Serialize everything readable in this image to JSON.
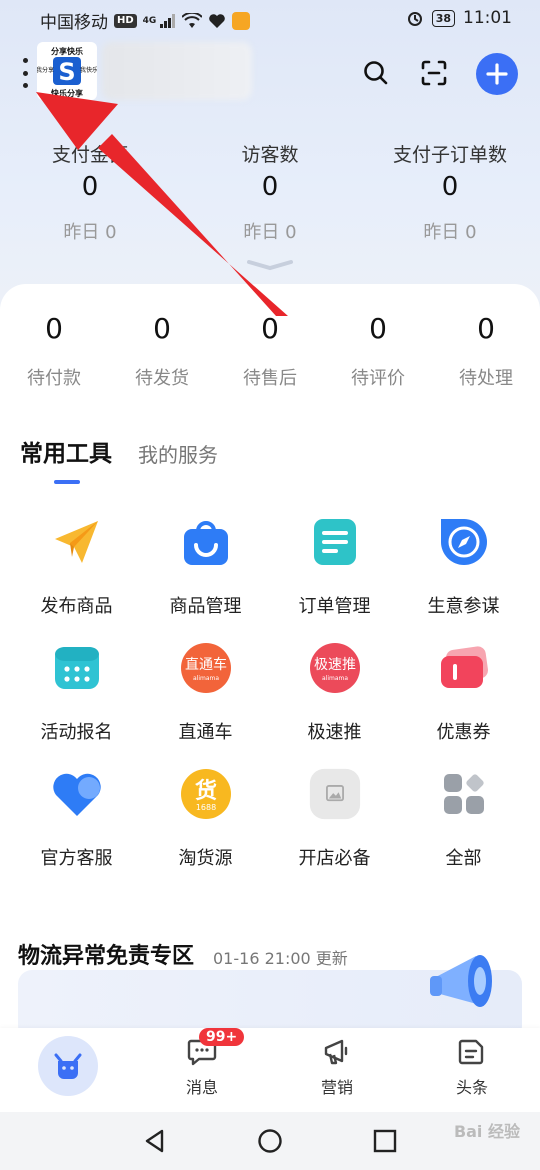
{
  "status_bar": {
    "carrier": "中国移动",
    "hd": "HD",
    "network": "4G",
    "battery": "38",
    "time": "11:01"
  },
  "header": {
    "logo_text_top": "分享快乐",
    "logo_text_bottom": "快乐分享",
    "logo_text_left": "我分享",
    "logo_text_right": "我快乐",
    "logo_letter": "S"
  },
  "stats": [
    {
      "label": "支付金额",
      "value": "0",
      "yesterday": "昨日 0"
    },
    {
      "label": "访客数",
      "value": "0",
      "yesterday": "昨日 0"
    },
    {
      "label": "支付子订单数",
      "value": "0",
      "yesterday": "昨日 0"
    }
  ],
  "orders": [
    {
      "value": "0",
      "label": "待付款"
    },
    {
      "value": "0",
      "label": "待发货"
    },
    {
      "value": "0",
      "label": "待售后"
    },
    {
      "value": "0",
      "label": "待评价"
    },
    {
      "value": "0",
      "label": "待处理"
    }
  ],
  "tabs": {
    "active": "常用工具",
    "other": "我的服务"
  },
  "tools": [
    {
      "label": "发布商品",
      "icon": "paper-plane-icon"
    },
    {
      "label": "商品管理",
      "icon": "shopping-bag-icon"
    },
    {
      "label": "订单管理",
      "icon": "document-icon"
    },
    {
      "label": "生意参谋",
      "icon": "compass-icon"
    },
    {
      "label": "活动报名",
      "icon": "calendar-icon"
    },
    {
      "label": "直通车",
      "icon": "zhitongche-icon",
      "icon_text": "直通车",
      "icon_sub": "alimama"
    },
    {
      "label": "极速推",
      "icon": "jisutui-icon",
      "icon_text": "极速推",
      "icon_sub": "alimama"
    },
    {
      "label": "优惠券",
      "icon": "coupon-icon"
    },
    {
      "label": "官方客服",
      "icon": "heart-chat-icon"
    },
    {
      "label": "淘货源",
      "icon": "taohuoyuan-icon",
      "icon_text": "货",
      "icon_sub": "1688"
    },
    {
      "label": "开店必备",
      "icon": "image-placeholder-icon"
    },
    {
      "label": "全部",
      "icon": "all-apps-icon"
    }
  ],
  "logistics": {
    "title": "物流异常免责专区",
    "updated": "01-16 21:00 更新"
  },
  "tabbar": [
    {
      "label": "",
      "icon": "home-ox-icon"
    },
    {
      "label": "消息",
      "icon": "message-icon",
      "badge": "99+"
    },
    {
      "label": "营销",
      "icon": "megaphone-icon"
    },
    {
      "label": "头条",
      "icon": "news-icon"
    }
  ],
  "watermark": "Bai 经验",
  "colors": {
    "accent": "#3b6ff5",
    "badge": "#f0353b",
    "arrow": "#e8262b"
  }
}
